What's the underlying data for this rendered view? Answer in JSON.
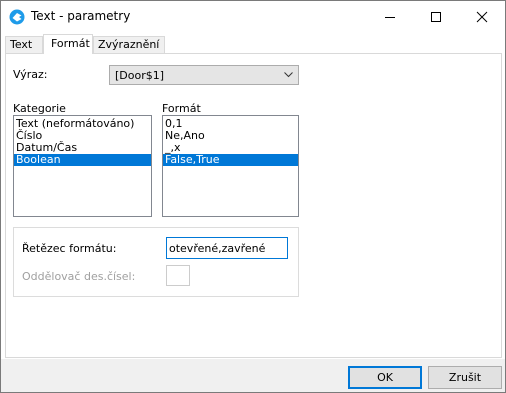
{
  "window": {
    "title": "Text - parametry",
    "icons": {
      "app": "app-icon",
      "minimize": "minimize-icon",
      "maximize": "maximize-icon",
      "close": "close-icon"
    }
  },
  "tabs": [
    {
      "label": "Text",
      "active": false
    },
    {
      "label": "Formát",
      "active": true
    },
    {
      "label": "Zvýraznění",
      "active": false
    }
  ],
  "expression": {
    "label": "Výraz:",
    "value": "[Door$1]",
    "dropdown_icon": "chevron-down-icon"
  },
  "category": {
    "label": "Kategorie",
    "items": [
      "Text (neformátováno)",
      "Číslo",
      "Datum/Čas",
      "Boolean"
    ],
    "selected": "Boolean"
  },
  "format": {
    "label": "Formát",
    "items": [
      "0,1",
      "Ne,Ano",
      "_,x",
      "False,True"
    ],
    "selected": "False,True"
  },
  "format_string": {
    "label": "Řetězec formátu:",
    "value": "otevřené,zavřené"
  },
  "decimal_separator": {
    "label": "Oddělovač des.čísel:",
    "value": ""
  },
  "buttons": {
    "ok": "OK",
    "cancel": "Zrušit"
  },
  "colors": {
    "accent": "#0078d7",
    "selection": "#0078d7",
    "footer_bg": "#f0f0f0"
  }
}
